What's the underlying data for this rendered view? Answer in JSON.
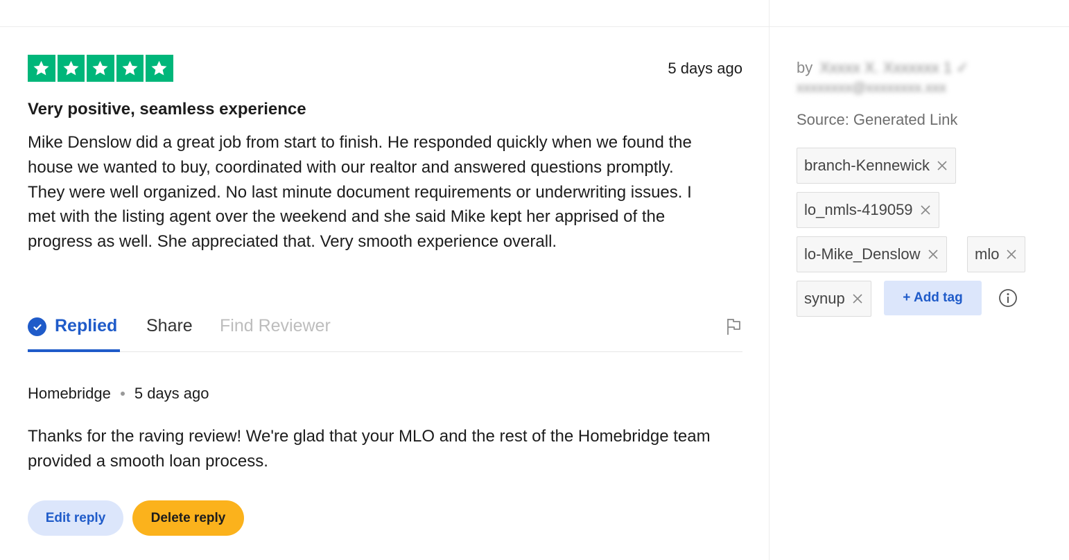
{
  "review": {
    "rating": 5,
    "max_rating": 5,
    "rating_color": "#00b67a",
    "date": "5 days ago",
    "title": "Very positive, seamless experience",
    "body": "Mike Denslow did a great job from start to finish. He responded quickly when we found the house we wanted to buy, coordinated with our realtor and answered questions promptly. They were well organized. No last minute document requirements or underwriting issues. I met with the listing agent over the weekend and she said Mike kept her apprised of the progress as well. She appreciated that. Very smooth experience overall."
  },
  "tabs": {
    "replied": "Replied",
    "share": "Share",
    "find_reviewer": "Find Reviewer"
  },
  "reply": {
    "author": "Homebridge",
    "date": "5 days ago",
    "text": "Thanks for the raving review! We're glad that your MLO and the rest of the Homebridge team provided a smooth loan process.",
    "edit_label": "Edit reply",
    "delete_label": "Delete reply"
  },
  "sidebar": {
    "by_label": "by",
    "source": "Source: Generated Link",
    "tags": [
      "branch-Kennewick",
      "lo_nmls-419059",
      "lo-Mike_Denslow",
      "mlo",
      "synup"
    ],
    "add_tag_label": "+ Add tag"
  },
  "colors": {
    "accent": "#1f5bc9",
    "accent_light": "#dce6fb",
    "delete_button": "#fbb21c",
    "star_green": "#00b67a"
  },
  "icons": [
    "star-icon",
    "check-circle-icon",
    "flag-icon",
    "close-icon",
    "info-icon"
  ]
}
